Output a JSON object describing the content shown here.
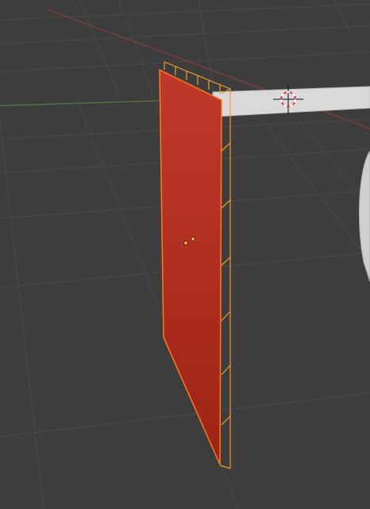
{
  "viewport": {
    "background": "#3d3d3d",
    "grid_color": "#4a4a4a",
    "grid_color_faint": "#444444",
    "x_axis_color": "#8a3c3c",
    "y_axis_color": "#58783a"
  },
  "objects": {
    "selected_panel": {
      "fill_light": "#c0392b",
      "fill_dark": "#9e2316",
      "outline_color": "#ff7a1a",
      "wire_color": "#f39a2a",
      "origin_color": "#f7a13a"
    },
    "horizontal_bar": {
      "fill": "#d9d9d9",
      "edge": "#bdbdbd"
    },
    "partial_object": {
      "fill": "#cfcfcf",
      "edge": "#a8a8a8"
    }
  },
  "cursor_3d": {
    "icon": "3d-cursor-icon",
    "ring_color_a": "#ffffff",
    "ring_color_b": "#e03a3a",
    "crosshair_color": "#111111"
  }
}
